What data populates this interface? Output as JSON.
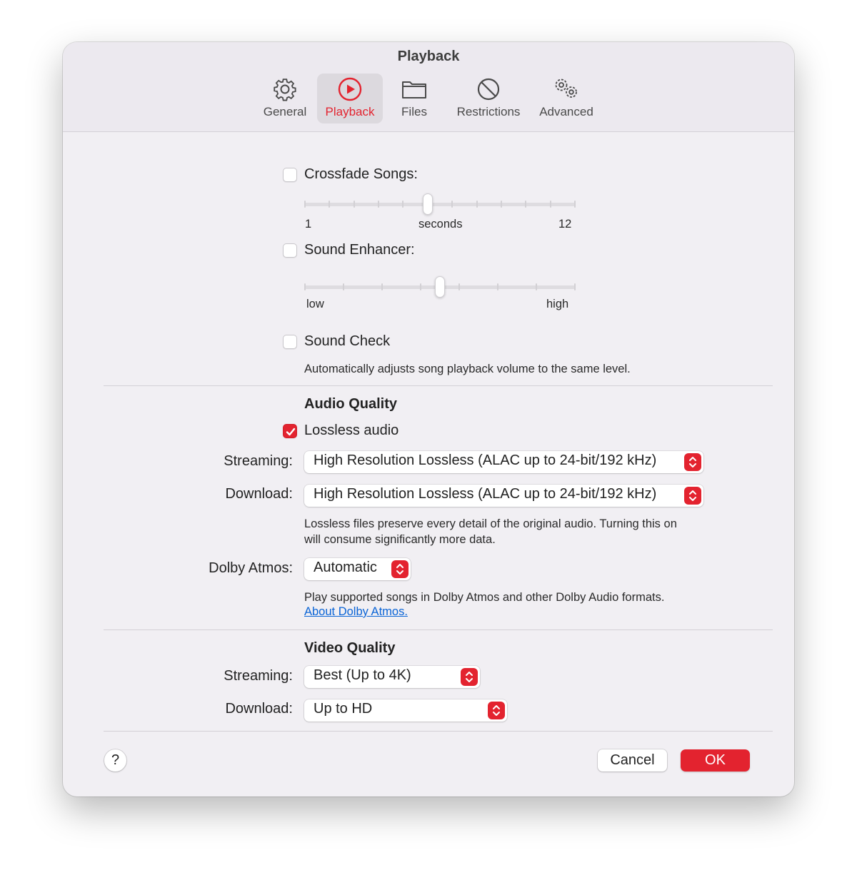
{
  "window": {
    "title": "Playback"
  },
  "tabs": [
    {
      "label": "General",
      "icon": "gear-icon"
    },
    {
      "label": "Playback",
      "icon": "play-circle-icon",
      "active": true
    },
    {
      "label": "Files",
      "icon": "folder-icon"
    },
    {
      "label": "Restrictions",
      "icon": "prohibited-icon"
    },
    {
      "label": "Advanced",
      "icon": "gears-icon"
    }
  ],
  "crossfade": {
    "label": "Crossfade Songs:",
    "checked": false,
    "min_label": "1",
    "mid_label": "seconds",
    "max_label": "12",
    "value": 6
  },
  "sound_enhancer": {
    "label": "Sound Enhancer:",
    "checked": false,
    "min_label": "low",
    "max_label": "high",
    "value_fraction": 0.5
  },
  "sound_check": {
    "label": "Sound Check",
    "checked": false,
    "description": "Automatically adjusts song playback volume to the same level."
  },
  "audio_quality": {
    "heading": "Audio Quality",
    "lossless_label": "Lossless audio",
    "lossless_checked": true,
    "streaming_label": "Streaming:",
    "streaming_value": "High Resolution Lossless (ALAC up to 24-bit/192 kHz)",
    "download_label": "Download:",
    "download_value": "High Resolution Lossless (ALAC up to 24-bit/192 kHz)",
    "lossless_note_1": "Lossless files preserve every detail of the original audio. Turning this on",
    "lossless_note_2": "will consume significantly more data.",
    "dolby_label": "Dolby Atmos:",
    "dolby_value": "Automatic",
    "dolby_note": "Play supported songs in Dolby Atmos and other Dolby Audio formats.",
    "dolby_link": "About Dolby Atmos."
  },
  "video_quality": {
    "heading": "Video Quality",
    "streaming_label": "Streaming:",
    "streaming_value": "Best (Up to 4K)",
    "download_label": "Download:",
    "download_value": "Up to HD"
  },
  "footer": {
    "help_label": "?",
    "cancel_label": "Cancel",
    "ok_label": "OK"
  },
  "colors": {
    "accent": "#e3232f",
    "window_bg": "#f1eff3",
    "link": "#0a64d6"
  }
}
